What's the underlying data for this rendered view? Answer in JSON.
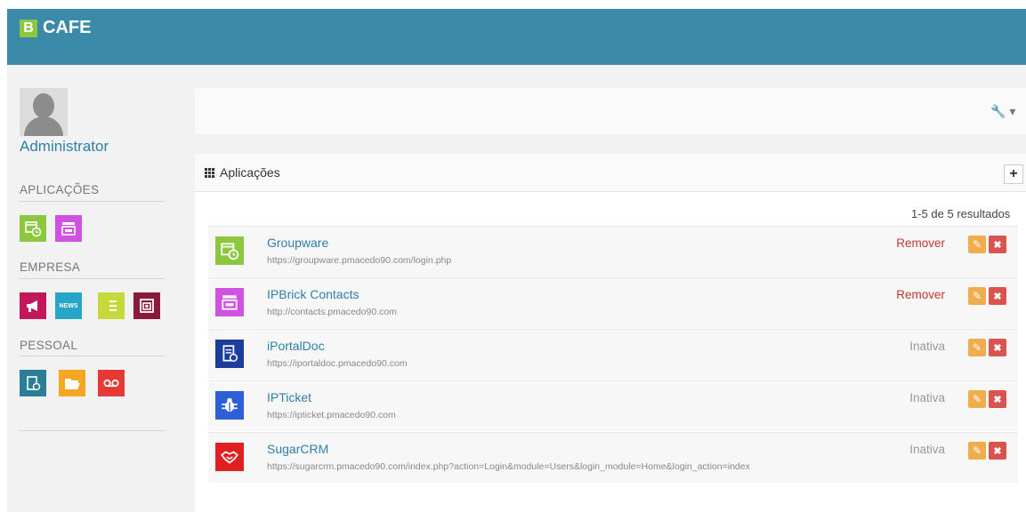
{
  "header": {
    "logo_letter": "B",
    "app_name": "CAFE"
  },
  "user": {
    "name": "Administrator"
  },
  "sidebar": {
    "sections": [
      {
        "title": "APLICAÇÕES",
        "tiles": [
          {
            "icon": "calendar-clock-icon",
            "color": "#8dc63f"
          },
          {
            "icon": "contacts-icon",
            "color": "#d052e0"
          }
        ]
      },
      {
        "title": "EMPRESA",
        "tiles": [
          {
            "icon": "megaphone-icon",
            "color": "#c2185b"
          },
          {
            "icon": "news-icon",
            "color": "#26a6c9",
            "text": "NEWS"
          },
          {
            "icon": "list-icon",
            "color": "#c6d83a"
          },
          {
            "icon": "photo-album-icon",
            "color": "#8b1a3a"
          }
        ]
      },
      {
        "title": "PESSOAL",
        "tiles": [
          {
            "icon": "document-edit-icon",
            "color": "#2a7f96"
          },
          {
            "icon": "folder-open-icon",
            "color": "#f5a623"
          },
          {
            "icon": "voicemail-icon",
            "color": "#e53935"
          }
        ]
      }
    ]
  },
  "panel": {
    "title": "Aplicações",
    "add_label": "+",
    "results_text": "1-5 de 5 resultados",
    "wrench_glyph": "🔧 ▾"
  },
  "apps": [
    {
      "name": "Groupware",
      "url": "https://groupware.pmacedo90.com/login.php",
      "status": "Remover",
      "status_kind": "remove",
      "icon": "calendar-clock-icon",
      "color": "#8dc63f"
    },
    {
      "name": "IPBrick Contacts",
      "url": "http://contacts.pmacedo90.com",
      "status": "Remover",
      "status_kind": "remove",
      "icon": "contacts-icon",
      "color": "#d052e0"
    },
    {
      "name": "iPortalDoc",
      "url": "https://iportaldoc.pmacedo90.com",
      "status": "Inativa",
      "status_kind": "inactive",
      "icon": "document-settings-icon",
      "color": "#1a3d9e"
    },
    {
      "name": "IPTicket",
      "url": "https://ipticket.pmacedo90.com",
      "status": "Inativa",
      "status_kind": "inactive",
      "icon": "bug-icon",
      "color": "#2d5fd6"
    },
    {
      "name": "SugarCRM",
      "url": "https://sugarcrm.pmacedo90.com/index.php?action=Login&module=Users&login_module=Home&login_action=index",
      "status": "Inativa",
      "status_kind": "inactive",
      "icon": "handshake-icon",
      "color": "#e02020"
    }
  ],
  "row_actions": {
    "edit_glyph": "✎",
    "delete_glyph": "✖"
  }
}
